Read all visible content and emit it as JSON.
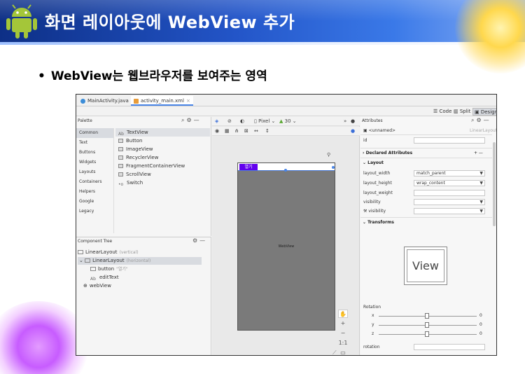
{
  "slide": {
    "title": "화면 레이아웃에 WebView 추가",
    "bullet_marker": "•",
    "bullet": "WebView는 웹브라우저를 보여주는 영역"
  },
  "ide": {
    "file_tabs": [
      {
        "label": "MainActivity.java",
        "close": "×"
      },
      {
        "label": "activity_main.xml",
        "close": "×"
      }
    ],
    "modes": {
      "code": "Code",
      "split": "Split",
      "design": "Design"
    },
    "palette": {
      "title": "Palette",
      "categories": [
        "Common",
        "Text",
        "Buttons",
        "Widgets",
        "Layouts",
        "Containers",
        "Helpers",
        "Google",
        "Legacy"
      ],
      "items": [
        {
          "icon": "Ab",
          "label": "TextView"
        },
        {
          "icon": "box",
          "label": "Button"
        },
        {
          "icon": "box",
          "label": "ImageView"
        },
        {
          "icon": "box",
          "label": "RecyclerView"
        },
        {
          "icon": "box",
          "label": "FragmentContainerView"
        },
        {
          "icon": "box",
          "label": "ScrollView"
        },
        {
          "icon": "•o",
          "label": "Switch"
        }
      ]
    },
    "tree": {
      "title": "Component Tree",
      "nodes": [
        {
          "label": "LinearLayout",
          "tag": "(vertical)"
        },
        {
          "label": "LinearLayout",
          "tag": "(horizontal)"
        },
        {
          "label": "button",
          "tag": "\"열기\""
        },
        {
          "label": "editText",
          "tag": ""
        },
        {
          "label": "webView",
          "tag": ""
        }
      ]
    },
    "toolbar": {
      "device": "Pixel",
      "api": "30"
    },
    "phone": {
      "button_label": "열기",
      "webview_label": "WebView"
    },
    "attributes": {
      "title": "Attributes",
      "component": "<unnamed>",
      "component_type": "LinearLayout",
      "id_label": "id",
      "declared": "Declared Attributes",
      "layout_section": "Layout",
      "rows": [
        {
          "label": "layout_width",
          "value": "match_parent"
        },
        {
          "label": "layout_height",
          "value": "wrap_content"
        },
        {
          "label": "layout_weight",
          "value": ""
        },
        {
          "label": "visibility",
          "value": ""
        },
        {
          "label": "visibility",
          "value": ""
        }
      ],
      "transforms": "Transforms",
      "view_text": "View",
      "rotation": "Rotation",
      "axes": [
        {
          "label": "x",
          "value": "0"
        },
        {
          "label": "y",
          "value": "0"
        },
        {
          "label": "z",
          "value": "0"
        }
      ],
      "rotation_field": "rotation"
    },
    "colors": {
      "button": "#6200ee",
      "canvas": "#7a7a7a",
      "selection": "#4a86e8"
    }
  }
}
